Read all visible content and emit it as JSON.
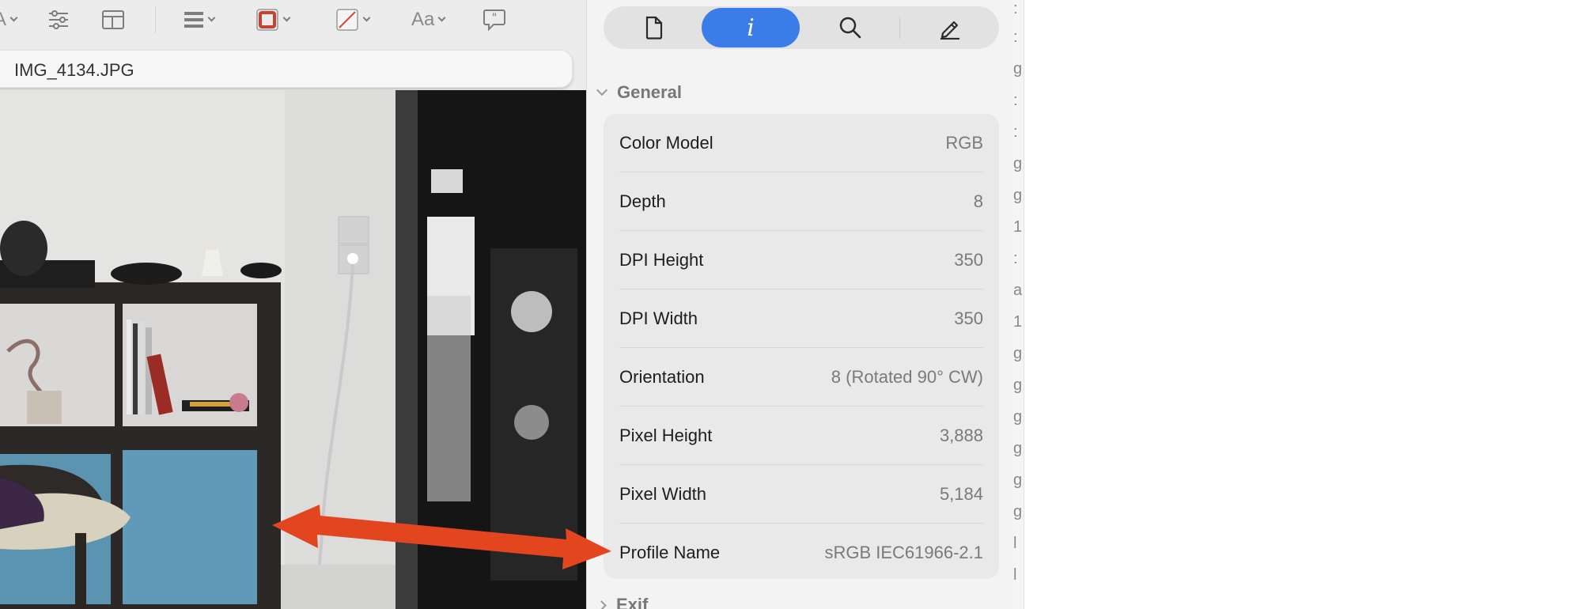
{
  "toolbar": {
    "partial_first_text": "A",
    "font_menu_label": "Aa",
    "icons": [
      "markup-shapes-icon",
      "adjust-sliders-icon",
      "layout-icon",
      "line-weight-icon",
      "border-color-icon",
      "fill-color-icon",
      "font-icon",
      "speech-bubble-icon"
    ],
    "border_color": "#c8432f"
  },
  "viewer": {
    "filename": "IMG_4134.JPG"
  },
  "inspector": {
    "tabs": [
      "document-icon",
      "info-icon",
      "search-icon",
      "annotate-icon"
    ],
    "active_tab": "info",
    "info_glyph": "i",
    "accent_color": "#3a7de8",
    "general": {
      "title": "General",
      "rows": [
        {
          "label": "Color Model",
          "value": "RGB"
        },
        {
          "label": "Depth",
          "value": "8"
        },
        {
          "label": "DPI Height",
          "value": "350"
        },
        {
          "label": "DPI Width",
          "value": "350"
        },
        {
          "label": "Orientation",
          "value": "8 (Rotated 90° CW)"
        },
        {
          "label": "Pixel Height",
          "value": "3,888"
        },
        {
          "label": "Pixel Width",
          "value": "5,184"
        },
        {
          "label": "Profile Name",
          "value": "sRGB IEC61966-2.1"
        }
      ]
    },
    "exif": {
      "title": "Exif"
    }
  },
  "background_window": {
    "visible_chars": [
      ":",
      ":",
      "g",
      ":",
      ":",
      "g",
      "g",
      "1",
      ":",
      "a",
      "1",
      "g",
      "g",
      "g",
      "g",
      "g",
      "g",
      "l",
      "l",
      "l"
    ]
  },
  "annotation": {
    "type": "double-headed-arrow",
    "color": "#e3461e"
  }
}
